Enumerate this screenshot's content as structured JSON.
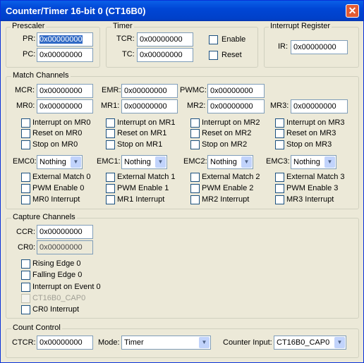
{
  "window": {
    "title": "Counter/Timer 16-bit 0 (CT16B0)",
    "close_glyph": "✕"
  },
  "prescaler": {
    "label": "Prescaler",
    "pr_label": "PR:",
    "pr_value": "0x00000000",
    "pc_label": "PC:",
    "pc_value": "0x00000000"
  },
  "timer": {
    "label": "Timer",
    "tcr_label": "TCR:",
    "tcr_value": "0x00000000",
    "tc_label": "TC:",
    "tc_value": "0x00000000",
    "enable_label": "Enable",
    "reset_label": "Reset"
  },
  "interrupt_register": {
    "label": "Interrupt Register",
    "ir_label": "IR:",
    "ir_value": "0x00000000"
  },
  "match": {
    "label": "Match Channels",
    "mcr_label": "MCR:",
    "mcr_value": "0x00000000",
    "emr_label": "EMR:",
    "emr_value": "0x00000000",
    "pwmc_label": "PWMC:",
    "pwmc_value": "0x00000000",
    "channels": [
      {
        "mr_label": "MR0:",
        "mr_value": "0x00000000",
        "int_label": "Interrupt on MR0",
        "reset_label": "Reset on MR0",
        "stop_label": "Stop on MR0",
        "emc_label": "EMC0:",
        "emc_value": "Nothing",
        "ext_label": "External Match 0",
        "pwm_label": "PWM Enable 0",
        "mrint_label": "MR0 Interrupt"
      },
      {
        "mr_label": "MR1:",
        "mr_value": "0x00000000",
        "int_label": "Interrupt on MR1",
        "reset_label": "Reset on MR1",
        "stop_label": "Stop on MR1",
        "emc_label": "EMC1:",
        "emc_value": "Nothing",
        "ext_label": "External Match 1",
        "pwm_label": "PWM Enable 1",
        "mrint_label": "MR1 Interrupt"
      },
      {
        "mr_label": "MR2:",
        "mr_value": "0x00000000",
        "int_label": "Interrupt on MR2",
        "reset_label": "Reset on MR2",
        "stop_label": "Stop on MR2",
        "emc_label": "EMC2:",
        "emc_value": "Nothing",
        "ext_label": "External Match 2",
        "pwm_label": "PWM Enable 2",
        "mrint_label": "MR2 Interrupt"
      },
      {
        "mr_label": "MR3:",
        "mr_value": "0x00000000",
        "int_label": "Interrupt on MR3",
        "reset_label": "Reset on MR3",
        "stop_label": "Stop on MR3",
        "emc_label": "EMC3:",
        "emc_value": "Nothing",
        "ext_label": "External Match 3",
        "pwm_label": "PWM Enable 3",
        "mrint_label": "MR3 Interrupt"
      }
    ]
  },
  "capture": {
    "label": "Capture Channels",
    "ccr_label": "CCR:",
    "ccr_value": "0x00000000",
    "cr0_label": "CR0:",
    "cr0_value": "0x00000000",
    "rising_label": "Rising Edge 0",
    "falling_label": "Falling Edge 0",
    "int_event_label": "Interrupt on Event 0",
    "cap_pin_label": "CT16B0_CAP0",
    "cr0_int_label": "CR0 Interrupt"
  },
  "count_control": {
    "label": "Count Control",
    "ctcr_label": "CTCR:",
    "ctcr_value": "0x00000000",
    "mode_label": "Mode:",
    "mode_value": "Timer",
    "input_label": "Counter Input:",
    "input_value": "CT16B0_CAP0"
  },
  "dropdown_arrow": "▼"
}
